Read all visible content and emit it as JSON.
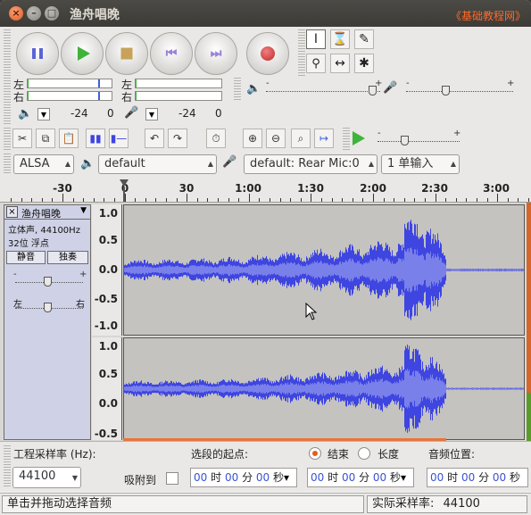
{
  "window": {
    "title": "渔舟唱晚",
    "watermark": "《基础教程网》",
    "close_glyph": "×",
    "min_glyph": "–",
    "max_glyph": "□"
  },
  "transport": {
    "buttons": [
      "pause",
      "play",
      "stop",
      "skip-to-start",
      "skip-to-end",
      "record"
    ],
    "skip_start_glyph": "⏮",
    "skip_end_glyph": "⏭"
  },
  "tools": {
    "items": [
      {
        "name": "selection-tool",
        "glyph": "I",
        "active": true
      },
      {
        "name": "envelope-tool",
        "glyph": "⌛",
        "active": false
      },
      {
        "name": "draw-tool",
        "glyph": "✎",
        "active": false
      },
      {
        "name": "zoom-tool",
        "glyph": "🔍",
        "active": false
      },
      {
        "name": "timeshift-tool",
        "glyph": "↔",
        "active": false
      },
      {
        "name": "multi-tool",
        "glyph": "✱",
        "active": false
      }
    ]
  },
  "meters": {
    "left_label": "左",
    "right_label": "右",
    "play_db": "-24",
    "play_zero": "0",
    "rec_db": "-24",
    "rec_zero": "0"
  },
  "mixer": {
    "minus": "-",
    "plus": "+"
  },
  "edit_toolbar": {
    "icons": [
      "cut-icon",
      "copy-icon",
      "paste-icon",
      "trim-icon",
      "silence-icon",
      "undo-icon",
      "redo-icon",
      "sync-lock-icon",
      "zoom-in-icon",
      "zoom-out-icon",
      "fit-selection-icon",
      "fit-project-icon"
    ]
  },
  "device": {
    "host": "ALSA",
    "output": "default",
    "input": "default: Rear Mic:0",
    "channels": "1 单输入"
  },
  "ruler": {
    "labels": [
      "-30",
      "0",
      "30",
      "1:00",
      "1:30",
      "2:00",
      "2:30",
      "3:00"
    ]
  },
  "track": {
    "name": "渔舟唱晚",
    "format_line1": "立体声, 44100Hz",
    "format_line2": "32位 浮点",
    "mute_label": "静音",
    "solo_label": "独奏",
    "pan_left": "左",
    "pan_right": "右",
    "scale_top": [
      "1.0",
      "0.5",
      "0.0",
      "-0.5",
      "-1.0"
    ],
    "scale_bottom": [
      "1.0",
      "0.5",
      "0.0",
      "-0.5"
    ]
  },
  "selection": {
    "project_rate_label": "工程采样率 (Hz):",
    "project_rate_value": "44100",
    "snap_label": "吸附到",
    "start_label": "选段的起点:",
    "end_label": "结束",
    "length_label": "长度",
    "position_label": "音频位置:",
    "time_value": {
      "h": "00",
      "h_unit": "时",
      "m": "00",
      "m_unit": "分",
      "s": "00",
      "s_unit": "秒"
    }
  },
  "status": {
    "message": "单击并拖动选择音频",
    "rate_label": "实际采样率:",
    "rate_value": "44100"
  },
  "colors": {
    "waveform": "#3e45e0",
    "waveform_rms": "#7a80ea",
    "selection_accent": "#e8763a"
  }
}
